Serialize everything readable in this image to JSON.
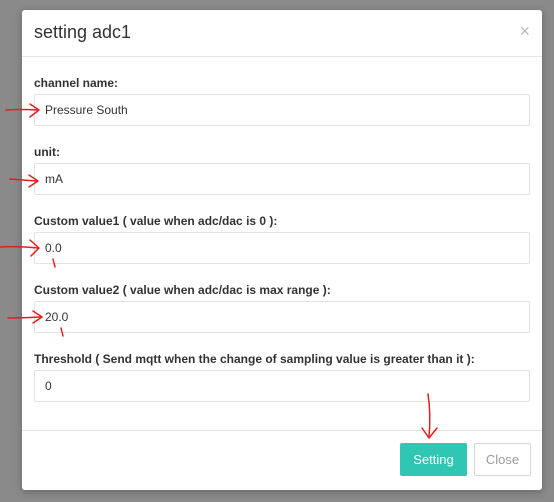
{
  "dialog": {
    "title": "setting adc1",
    "close_glyph": "×"
  },
  "fields": [
    {
      "label": "channel name:",
      "value": "Pressure South"
    },
    {
      "label": "unit:",
      "value": "mA"
    },
    {
      "label": "Custom value1 ( value when adc/dac is 0 ):",
      "value": "0.0"
    },
    {
      "label": "Custom value2 ( value when adc/dac is max range ):",
      "value": "20.0"
    },
    {
      "label": "Threshold ( Send mqtt when the change of sampling value is greater than it ):",
      "value": "0"
    }
  ],
  "footer": {
    "setting_label": "Setting",
    "close_label": "Close"
  },
  "colors": {
    "primary_button": "#2fc7b3",
    "annotation_marks": "#e02020"
  }
}
